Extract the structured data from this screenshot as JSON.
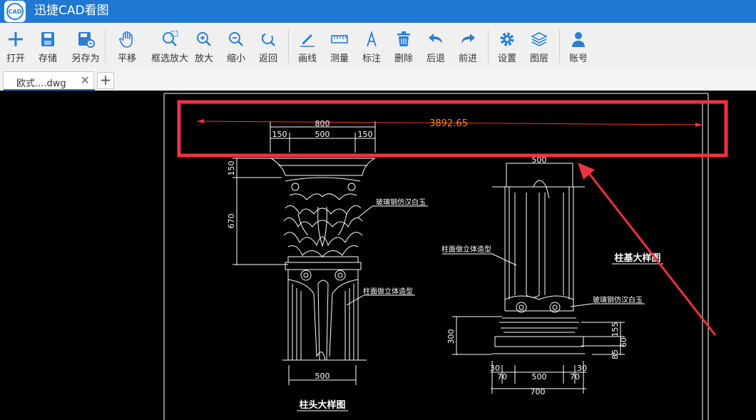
{
  "app": {
    "title": "迅捷CAD看图",
    "logo_text": "CAD"
  },
  "toolbar": {
    "open": "打开",
    "save": "存储",
    "save_as": "另存为",
    "pan": "平移",
    "zoom_window": "框选放大",
    "zoom_in": "放大",
    "zoom_out": "缩小",
    "back": "返回",
    "draw_line": "画线",
    "measure": "测量",
    "annotate": "标注",
    "delete": "删除",
    "undo": "后退",
    "redo": "前进",
    "settings": "设置",
    "layers": "图层",
    "account": "账号"
  },
  "tabs": {
    "active_label": "欧式....dwg",
    "close": "✕",
    "add": "+"
  },
  "drawing": {
    "measured_distance": "3892.65",
    "capital": {
      "top_total": "800",
      "side_left": "150",
      "middle": "500",
      "side_right": "150",
      "dim_height_top": "150",
      "dim_height_main": "670",
      "note_upper": "玻璃钢仿汉白玉",
      "note_lower": "柱面做立体造型",
      "bottom_width": "500",
      "title": "柱头大样图"
    },
    "base": {
      "top_width": "500",
      "note_upper": "柱面做立体造型",
      "note_lower": "玻璃钢仿汉白玉",
      "title": "柱基大样图",
      "dim_left_height": "300",
      "dim_right_1": "155",
      "dim_right_2": "60",
      "dim_right_3": "85",
      "bottom_left_outer": "30",
      "bottom_left_inner": "70",
      "bottom_middle": "500",
      "bottom_right_inner": "70",
      "bottom_right_outer": "30",
      "bottom_total": "700"
    }
  },
  "colors": {
    "accent": "#1f78d1",
    "highlight": "#ef3340",
    "measure_text": "#ff8a00"
  }
}
